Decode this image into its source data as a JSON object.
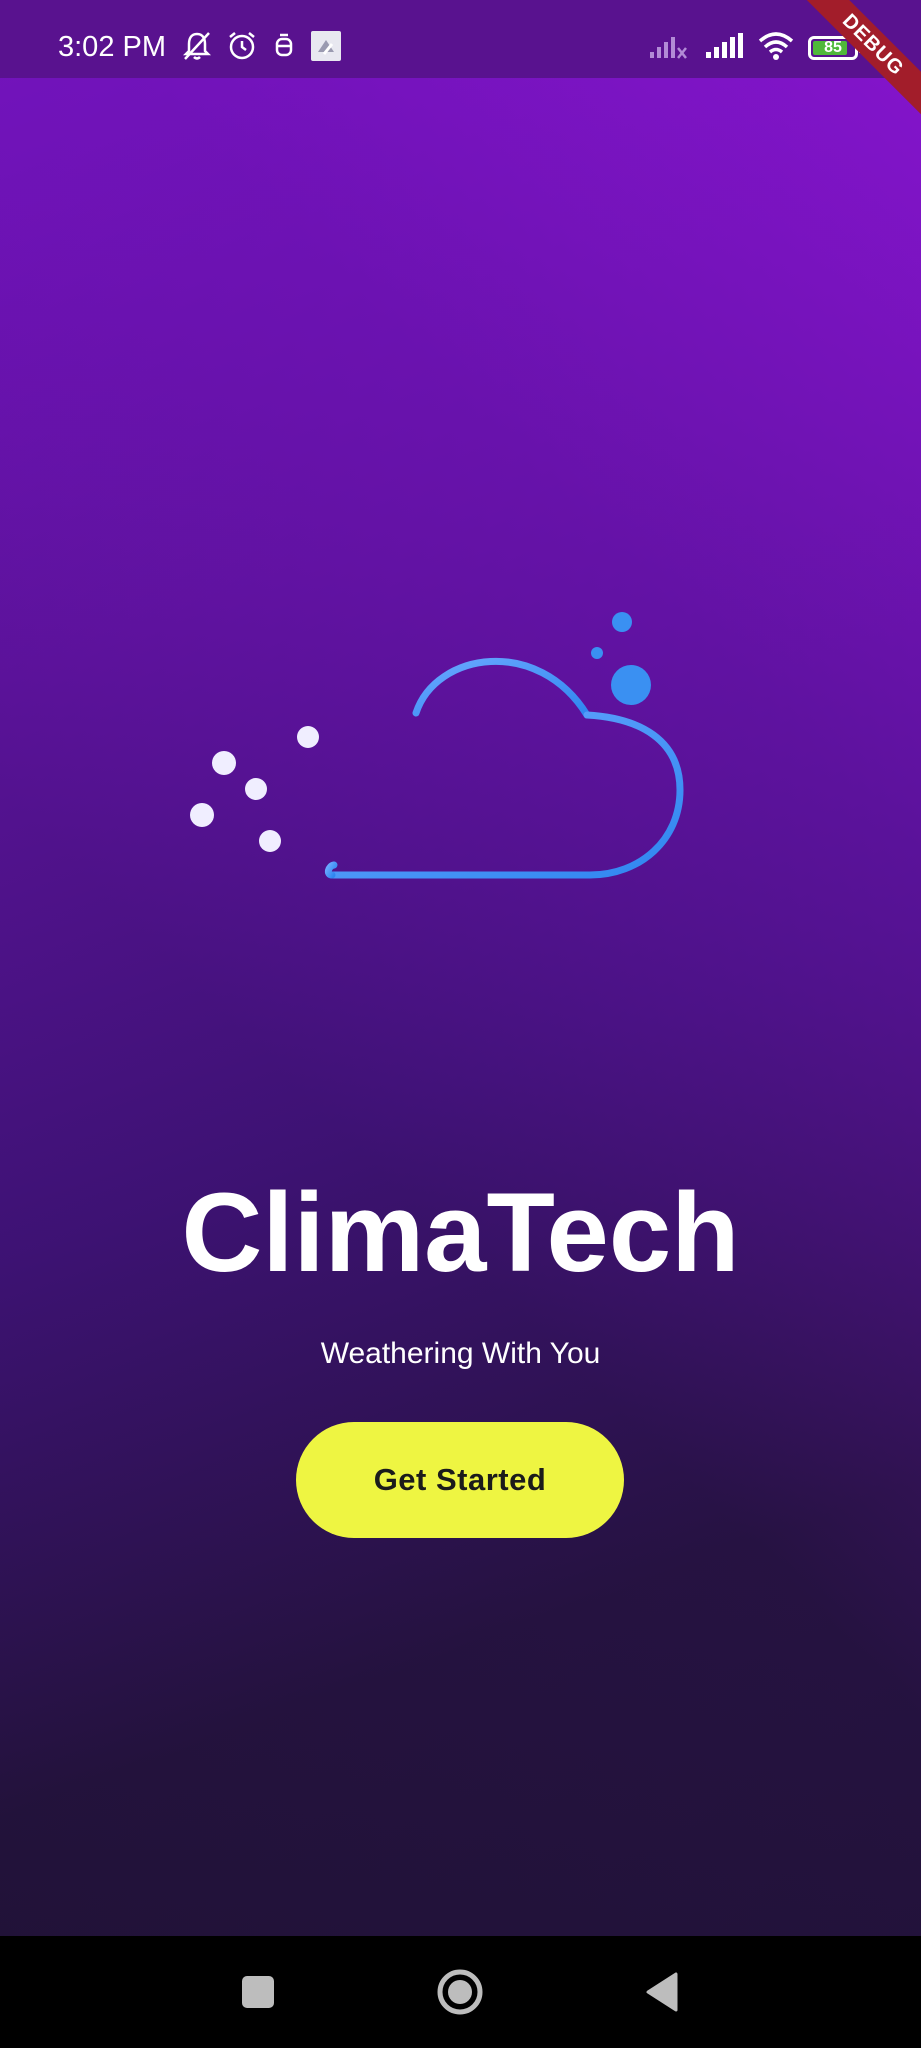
{
  "status_bar": {
    "time": "3:02 PM",
    "battery_level": "85",
    "battery_fraction": 0.85,
    "left_icons": [
      "bell-off-icon",
      "alarm-clock-icon",
      "notification-app-icon",
      "image-icon"
    ],
    "right_icons": [
      "signal-no-service-icon",
      "signal-bars-icon",
      "wifi-icon",
      "battery-icon"
    ]
  },
  "debug_banner": "DEBUG",
  "app": {
    "logo": "cloud-wind-logo",
    "title": "ClimaTech",
    "tagline": "Weathering With You",
    "cta_label": "Get Started"
  },
  "colors": {
    "background_top": "#7a14c9",
    "background_bottom": "#1f1234",
    "button": "#eef542",
    "logo_gradient_start": "#ffffff",
    "logo_gradient_end": "#2f86f0"
  },
  "nav_bar": {
    "buttons": [
      "recent-apps",
      "home",
      "back"
    ]
  }
}
